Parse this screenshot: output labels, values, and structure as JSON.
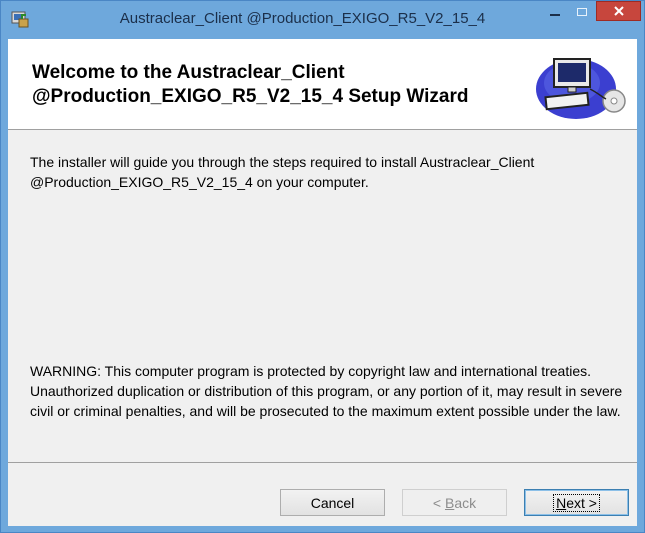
{
  "window": {
    "title": "Austraclear_Client @Production_EXIGO_R5_V2_15_4",
    "icons": {
      "app": "installer-icon",
      "minimize": "minimize-icon",
      "maximize": "maximize-icon",
      "close": "close-icon"
    }
  },
  "banner": {
    "title": "Welcome to the Austraclear_Client @Production_EXIGO_R5_V2_15_4 Setup Wizard",
    "graphic": "computer-setup-icon"
  },
  "content": {
    "intro": "The installer will guide you through the steps required to install Austraclear_Client @Production_EXIGO_R5_V2_15_4 on your computer.",
    "warning": "WARNING: This computer program is protected by copyright law and international treaties. Unauthorized duplication or distribution of this program, or any portion of it, may result in severe civil or criminal penalties, and will be prosecuted to the maximum extent possible under the law."
  },
  "buttons": {
    "cancel": "Cancel",
    "back_prefix": "< ",
    "back_mnemonic": "B",
    "back_rest": "ack",
    "next_mnemonic": "N",
    "next_rest": "ext >"
  },
  "colors": {
    "titlebar": "#6ea8dc",
    "close_button": "#c7463d",
    "dialog_background": "#f0f0f0"
  }
}
